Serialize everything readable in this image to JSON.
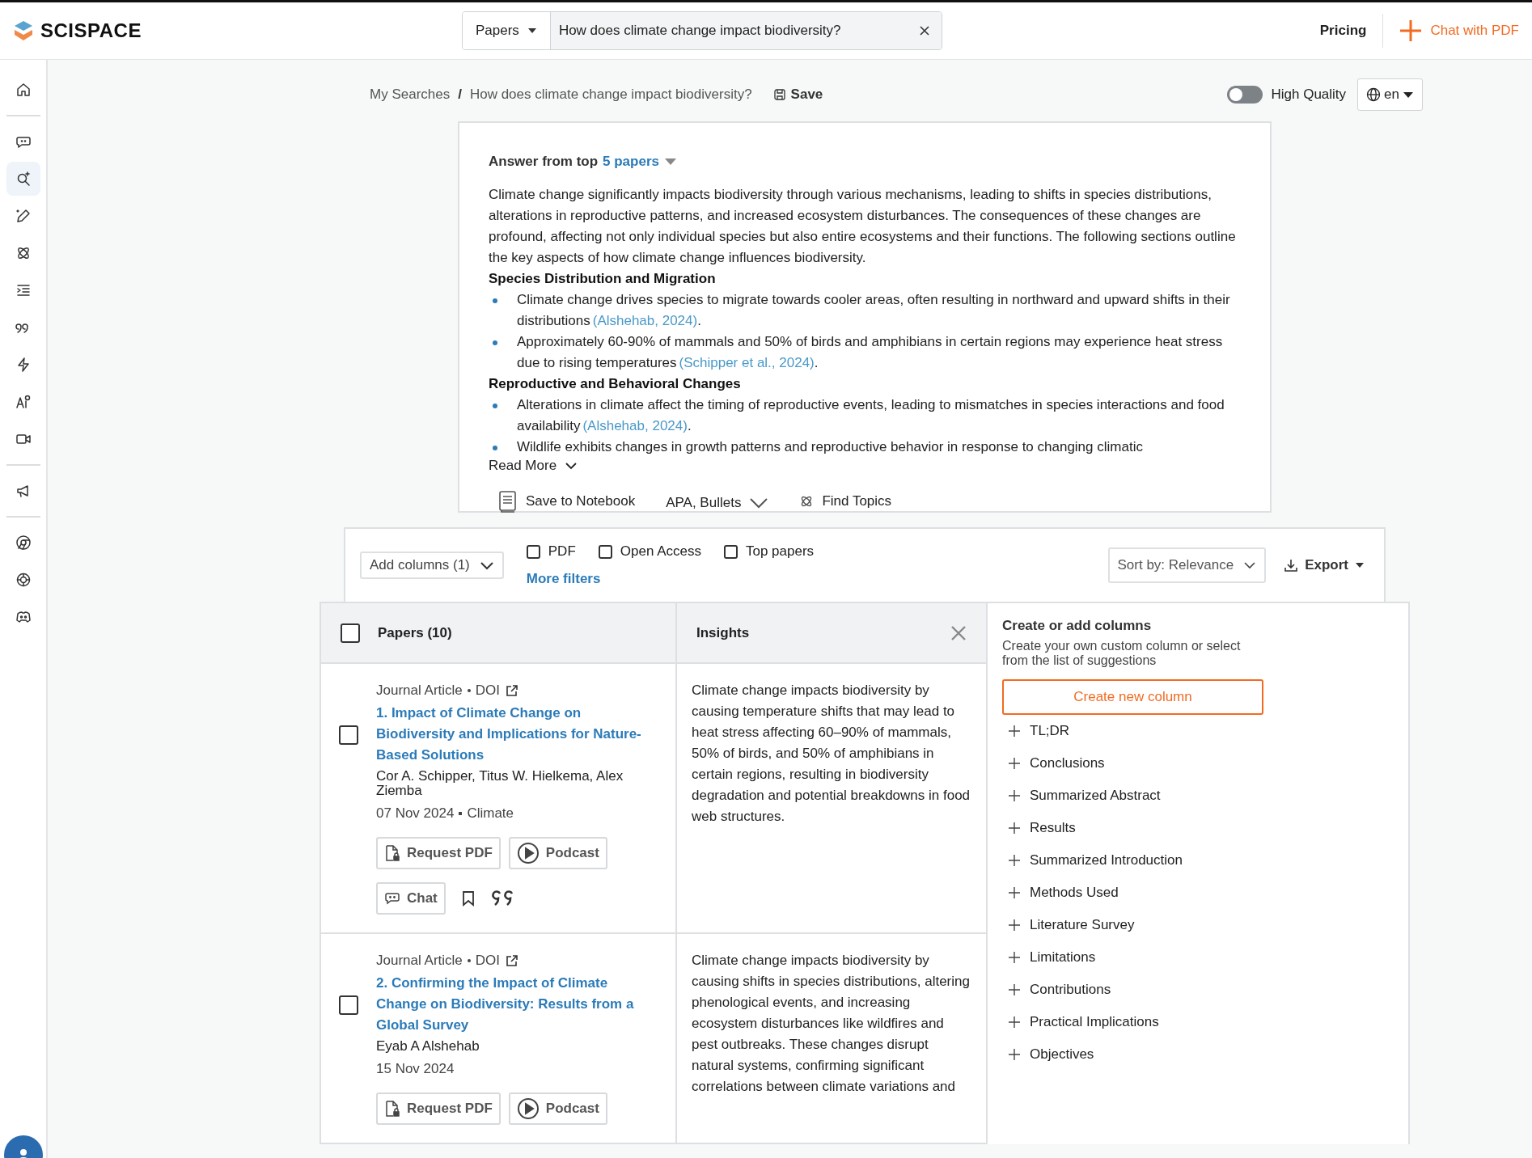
{
  "header": {
    "logo": "SCISPACE",
    "search": {
      "scope": "Papers",
      "value": "How does climate change impact biodiversity?"
    },
    "pricing": "Pricing",
    "chat_pdf": "Chat with PDF"
  },
  "sidebar": {
    "groups": [
      {
        "items": [
          {
            "selected": false
          }
        ]
      },
      {
        "items": [
          {
            "selected": false
          },
          {
            "selected": true
          },
          {
            "selected": false
          },
          {
            "selected": false
          },
          {
            "selected": false
          },
          {
            "selected": false
          },
          {
            "selected": false
          },
          {
            "selected": false
          },
          {
            "selected": false
          }
        ]
      },
      {
        "items": [
          {
            "selected": false
          }
        ]
      },
      {
        "items": [
          {
            "selected": false
          },
          {
            "selected": false
          },
          {
            "selected": false
          }
        ]
      }
    ]
  },
  "breadcrumb": {
    "items": [
      "My Searches",
      "How does climate change impact biodiversity?"
    ],
    "separator": "/",
    "save": "Save"
  },
  "quality": {
    "label": "High Quality",
    "on": false
  },
  "language": "en",
  "answer": {
    "lead": "Answer from top",
    "papers_link": "5 papers",
    "intro": "Climate change significantly impacts biodiversity through various mechanisms, leading to shifts in species distributions, alterations in reproductive patterns, and increased ecosystem disturbances. The consequences of these changes are profound, affecting not only individual species but also entire ecosystems and their functions. The following sections outline the key aspects of how climate change influences biodiversity.",
    "sections": [
      {
        "heading": "Species Distribution and Migration",
        "bullets": [
          {
            "text": "Climate change drives species to migrate towards cooler areas, often resulting in northward and upward shifts in their distributions",
            "citation": "(Alshehab, 2024)",
            "end": "."
          },
          {
            "text": "Approximately 60-90% of mammals and 50% of birds and amphibians in certain regions may experience heat stress due to rising temperatures",
            "citation": "(Schipper et al., 2024)",
            "end": "."
          }
        ]
      },
      {
        "heading": "Reproductive and Behavioral Changes",
        "bullets": [
          {
            "text": "Alterations in climate affect the timing of reproductive events, leading to mismatches in species interactions and food availability",
            "citation": "(Alshehab, 2024)",
            "end": "."
          },
          {
            "text": "Wildlife exhibits changes in growth patterns and reproductive behavior in response to changing climatic"
          }
        ]
      }
    ],
    "read_more": "Read More",
    "actions": {
      "notebook": "Save to Notebook",
      "format": "APA, Bullets",
      "topics": "Find Topics"
    }
  },
  "filters": {
    "add_columns": "Add columns (1)",
    "checkboxes": [
      {
        "label": "PDF",
        "checked": false
      },
      {
        "label": "Open Access",
        "checked": false
      },
      {
        "label": "Top papers",
        "checked": false
      }
    ],
    "more": "More filters",
    "sort": "Sort by: Relevance",
    "export": "Export"
  },
  "table": {
    "papers_header": "Papers (10)",
    "select_all": false,
    "insights_header": "Insights",
    "rows": [
      {
        "checked": false,
        "type": "Journal Article",
        "doi": "DOI",
        "title": "1. Impact of Climate Change on Biodiversity and Implications for Nature-Based Solutions",
        "authors": "Cor A. Schipper, Titus W. Hielkema, Alex Ziemba",
        "date": "07 Nov 2024",
        "venue": "Climate",
        "request_pdf": "Request PDF",
        "podcast": "Podcast",
        "chat": "Chat",
        "insight": "Climate change impacts biodiversity by causing temperature shifts that may lead to heat stress affecting 60–90% of mammals, 50% of birds, and 50% of amphibians in certain regions, resulting in biodiversity degradation and potential breakdowns in food web structures."
      },
      {
        "checked": false,
        "type": "Journal Article",
        "doi": "DOI",
        "title": "2. Confirming the Impact of Climate Change on Biodiversity: Results from a Global Survey",
        "authors": "Eyab A Alshehab",
        "date": "15 Nov 2024",
        "request_pdf": "Request PDF",
        "podcast": "Podcast",
        "insight": "Climate change impacts biodiversity by causing shifts in species distributions, altering phenological events, and increasing ecosystem disturbances like wildfires and pest outbreaks. These changes disrupt natural systems, confirming significant correlations between climate variations and"
      }
    ]
  },
  "columns_panel": {
    "title": "Create or add columns",
    "description": "Create your own custom column or select from the list of suggestions",
    "create": "Create new column",
    "suggestions": [
      "TL;DR",
      "Conclusions",
      "Summarized Abstract",
      "Results",
      "Summarized Introduction",
      "Methods Used",
      "Literature Survey",
      "Limitations",
      "Contributions",
      "Practical Implications",
      "Objectives"
    ]
  }
}
